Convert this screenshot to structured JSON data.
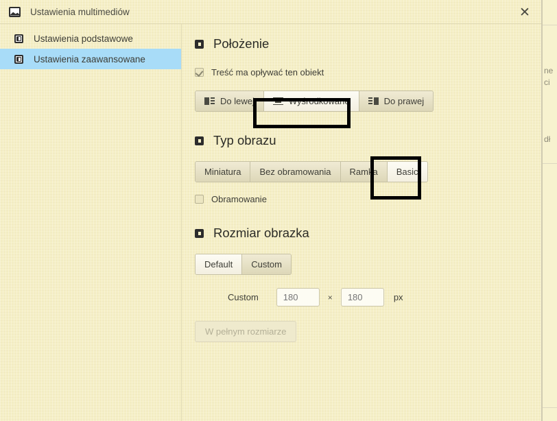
{
  "window": {
    "title": "Ustawienia multimediów",
    "title_icon": "image-icon",
    "close_icon": "✕"
  },
  "sidebar": {
    "items": [
      {
        "label": "Ustawienia podstawowe",
        "icon": "panel-icon",
        "selected": false
      },
      {
        "label": "Ustawienia zaawansowane",
        "icon": "panel-icon",
        "selected": true
      }
    ],
    "selected_bg": "#a8dcf8"
  },
  "sections": {
    "position": {
      "title": "Położenie",
      "icon": "section-square-icon",
      "checkbox": {
        "label": "Treść ma opływać ten obiekt",
        "checked": true
      },
      "align_buttons": [
        {
          "label": "Do lewej",
          "icon": "align-left-icon",
          "active": false
        },
        {
          "label": "Wyśrodkowane",
          "icon": "align-center-icon",
          "active": true
        },
        {
          "label": "Do prawej",
          "icon": "align-right-icon",
          "active": false
        }
      ]
    },
    "image_type": {
      "title": "Typ obrazu",
      "icon": "section-square-icon",
      "type_buttons": [
        {
          "label": "Miniatura",
          "active": false
        },
        {
          "label": "Bez obramowania",
          "active": false
        },
        {
          "label": "Ramka",
          "active": false
        },
        {
          "label": "Basic",
          "active": true
        }
      ],
      "checkbox": {
        "label": "Obramowanie",
        "checked": false
      }
    },
    "image_size": {
      "title": "Rozmiar obrazka",
      "icon": "section-square-icon",
      "mode_buttons": [
        {
          "label": "Default",
          "active": true
        },
        {
          "label": "Custom",
          "active": false
        }
      ],
      "custom_label": "Custom",
      "width_value": "180",
      "width_placeholder": "180",
      "separator": "×",
      "height_value": "180",
      "height_placeholder": "180",
      "unit": "px",
      "full_size_button": {
        "label": "W pełnym rozmiarze",
        "disabled": true
      }
    }
  },
  "background_page": {
    "fragments": [
      "ne",
      "ci",
      "dł"
    ]
  },
  "colors": {
    "dialog_bg": "#f5efc6",
    "sidebar_selected": "#a8dcf8",
    "text": "#3d3d36",
    "highlight_border": "#000000"
  }
}
